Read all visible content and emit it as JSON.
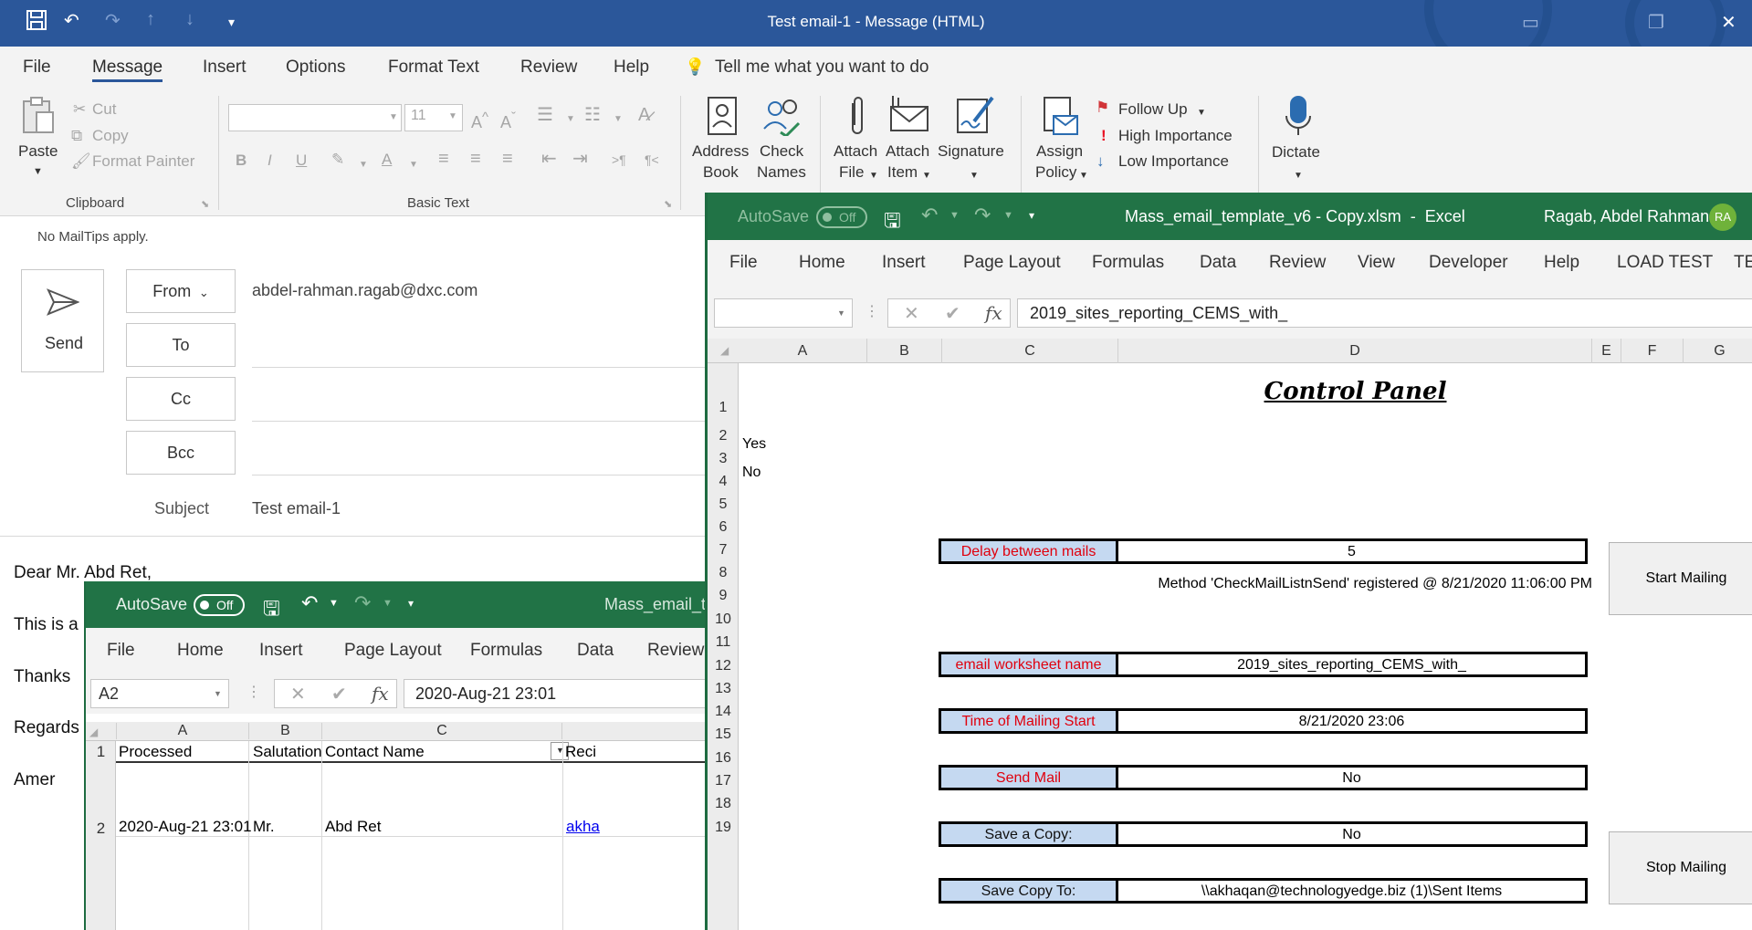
{
  "outlook": {
    "title": "Test email-1  -  Message (HTML)",
    "tabs": [
      "File",
      "Message",
      "Insert",
      "Options",
      "Format Text",
      "Review",
      "Help"
    ],
    "active_tab": "Message",
    "tell_me": "Tell me what you want to do",
    "clipboard": {
      "paste": "Paste",
      "cut": "Cut",
      "copy": "Copy",
      "format_painter": "Format Painter",
      "group": "Clipboard"
    },
    "basic_text": {
      "font_size": "11",
      "group": "Basic Text"
    },
    "names": {
      "address_book_1": "Address",
      "address_book_2": "Book",
      "check_names_1": "Check",
      "check_names_2": "Names"
    },
    "include": {
      "attach_file_1": "Attach",
      "attach_file_2": "File",
      "attach_item_1": "Attach",
      "attach_item_2": "Item",
      "signature": "Signature"
    },
    "tags": {
      "assign_policy_1": "Assign",
      "assign_policy_2": "Policy",
      "follow_up": "Follow Up",
      "high_importance": "High Importance",
      "low_importance": "Low Importance"
    },
    "voice": {
      "dictate": "Dictate"
    },
    "mailtips": "No MailTips apply.",
    "send": "Send",
    "from_label": "From",
    "from_value": "abdel-rahman.ragab@dxc.com",
    "to_label": "To",
    "cc_label": "Cc",
    "bcc_label": "Bcc",
    "subject_label": "Subject",
    "subject_value": "Test email-1",
    "body": [
      "Dear Mr. Abd Ret,",
      "This is a",
      "Thanks",
      "Regards",
      "Amer"
    ]
  },
  "excel_small": {
    "autosave": "AutoSave",
    "toggle": "Off",
    "title": "Mass_email_te",
    "tabs": [
      "File",
      "Home",
      "Insert",
      "Page Layout",
      "Formulas",
      "Data",
      "Review"
    ],
    "name_box": "A2",
    "formula": "2020-Aug-21 23:01",
    "columns": [
      "A",
      "B",
      "C"
    ],
    "headers": {
      "row": "1",
      "a": "Processed",
      "b": "Salutation",
      "c": "Contact Name",
      "d": "Reci"
    },
    "row2": {
      "row": "2",
      "a": "2020-Aug-21 23:01",
      "b": "Mr.",
      "c": "Abd Ret",
      "d": "akha"
    }
  },
  "excel_big": {
    "autosave": "AutoSave",
    "toggle": "Off",
    "title": "Mass_email_template_v6 - Copy.xlsm  -  Excel",
    "user": "Ragab, Abdel Rahman",
    "initials": "RA",
    "tabs": [
      "File",
      "Home",
      "Insert",
      "Page Layout",
      "Formulas",
      "Data",
      "Review",
      "View",
      "Developer",
      "Help",
      "LOAD TEST",
      "TE"
    ],
    "formula": "2019_sites_reporting_CEMS_with_",
    "columns": [
      "A",
      "B",
      "C",
      "D",
      "E",
      "F",
      "G"
    ],
    "rows": [
      "1",
      "2",
      "3",
      "4",
      "5",
      "6",
      "7",
      "8",
      "9",
      "10",
      "11",
      "12",
      "13",
      "14",
      "15",
      "16",
      "17",
      "18",
      "19"
    ],
    "a2": "Yes",
    "a3": "No",
    "panel_title": "Control Panel",
    "delay_label": "Delay between mails",
    "delay_value": "5",
    "method_note": "Method 'CheckMailListnSend' registered @ 8/21/2020 11:06:00 PM",
    "ws_label": "email worksheet name",
    "ws_value": "2019_sites_reporting_CEMS_with_",
    "time_label": "Time of Mailing Start",
    "time_value": "8/21/2020 23:06",
    "send_label": "Send Mail",
    "send_value": "No",
    "save_label": "Save a Copy:",
    "save_value": "No",
    "saveto_label": "Save Copy To:",
    "saveto_value": "\\\\akhaqan@technologyedge.biz (1)\\Sent Items",
    "start_button": "Start Mailing",
    "stop_button": "Stop Mailing"
  },
  "colors": {
    "outlook_blue": "#2b579a",
    "excel_green": "#217346",
    "label_fill": "#c5d9f1",
    "label_red": "#e0000d"
  }
}
